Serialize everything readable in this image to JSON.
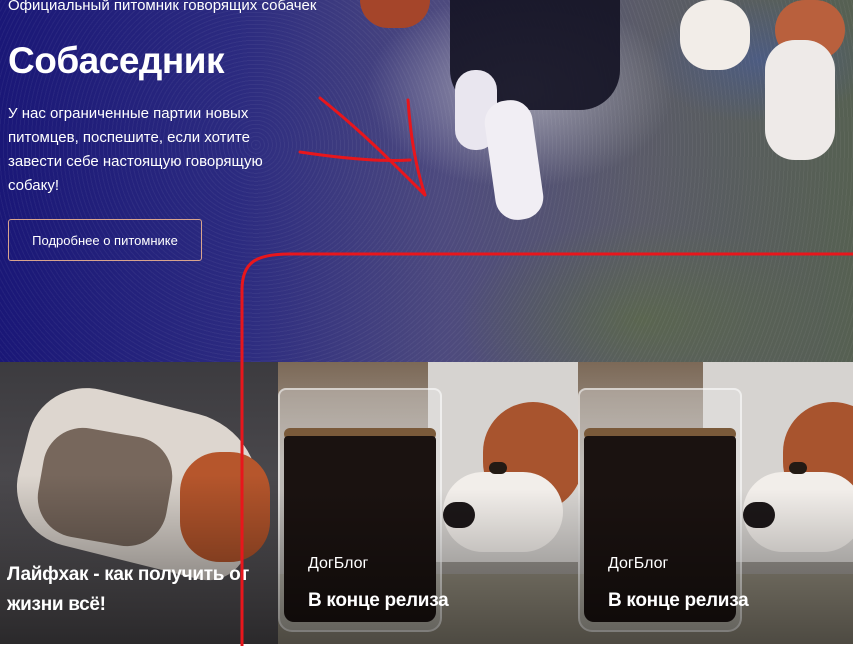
{
  "hero": {
    "tagline": "Официальный питомник говорящих собачек",
    "title": "Собаседник",
    "description": "У нас ограниченные партии новых питомцев, поспешите, если хотите завести себе настоящую говорящую собаку!",
    "button_label": "Подробнее о питомнике"
  },
  "cards": [
    {
      "title": "Лайфхак - как получить от жизни всё!"
    },
    {
      "category": "ДогБлог",
      "title": "В конце релиза"
    },
    {
      "category": "ДогБлог",
      "title": "В конце релиза"
    }
  ],
  "colors": {
    "annotation": "#e8161c",
    "button_border": "#d9a48e",
    "hero_overlay": "#1a1777"
  }
}
